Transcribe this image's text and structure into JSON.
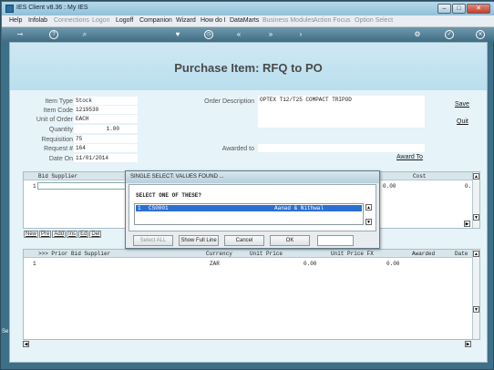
{
  "window": {
    "title": "IES Client v8.36 : My IES",
    "min": "–",
    "max": "□",
    "close": "✕"
  },
  "menu": [
    {
      "label": "Help",
      "enabled": true
    },
    {
      "label": "Infolab",
      "enabled": true
    },
    {
      "label": "Connections",
      "enabled": false
    },
    {
      "label": "Logon",
      "enabled": false
    },
    {
      "label": "Logoff",
      "enabled": true
    },
    {
      "label": "Companion",
      "enabled": true
    },
    {
      "label": "Wizard",
      "enabled": true
    },
    {
      "label": "How do I",
      "enabled": true
    },
    {
      "label": "DataMarts",
      "enabled": true
    },
    {
      "label": "Business Modules",
      "enabled": false
    },
    {
      "label": "Action Focus",
      "enabled": false
    },
    {
      "label": "Option Select",
      "enabled": false
    }
  ],
  "toolbar_icons": [
    "key-icon",
    "help-icon",
    "search-icon",
    "heart-icon",
    "clock-icon",
    "rewind-icon",
    "fast-forward-icon",
    "forward-icon",
    "gear-icon",
    "check-icon",
    "close-icon"
  ],
  "page": {
    "title": "Purchase Item: RFQ to PO"
  },
  "fields": {
    "item_type": {
      "label": "Item Type",
      "value": "Stock"
    },
    "item_code": {
      "label": "Item Code",
      "value": "1219530"
    },
    "unit_of_order": {
      "label": "Unit of Order",
      "value": "EACH"
    },
    "quantity": {
      "label": "Quantity",
      "value": "1.00"
    },
    "requisition": {
      "label": "Requisition",
      "value": "75"
    },
    "request_no": {
      "label": "Request #",
      "value": "164"
    },
    "date_on": {
      "label": "Date On",
      "value": "11/01/2014"
    },
    "order_description": {
      "label": "Order Description",
      "value": "OPTEX T12/T25 COMPACT TRIPOD"
    },
    "awarded_to": {
      "label": "Awarded to",
      "value": ""
    }
  },
  "actions": {
    "save": "Save",
    "quit": "Quit",
    "award_to": "Award To"
  },
  "bid_grid": {
    "columns": [
      "Bid Supplier",
      "Cost"
    ],
    "rows": [
      {
        "num": "1",
        "supplier": "",
        "cost": "0.00",
        "extra": "0."
      }
    ]
  },
  "row_buttons": [
    "New",
    "Pre",
    "Add",
    "Ins",
    "Ed",
    "Del"
  ],
  "prior_grid": {
    "columns": [
      ">>> Prior Bid Supplier",
      "Currency",
      "Unit Price",
      "Unit Price FX",
      "Awarded",
      "Date"
    ],
    "rows": [
      {
        "num": "1",
        "supplier": "",
        "currency": "ZAR",
        "unit_price": "0.00",
        "unit_price_fx": "0.00",
        "awarded": "",
        "date": ""
      }
    ]
  },
  "dialog": {
    "title": "SINGLE SELECT: VALUES FOUND ...",
    "prompt": "SELECT ONE OF THESE?",
    "items": [
      {
        "num": "1",
        "code": "CS0001",
        "name": "Aanad & Nithwal"
      }
    ],
    "buttons": {
      "select_all": "Select ALL",
      "show_full_line": "Show Full Line",
      "cancel": "Cancel",
      "ok": "OK"
    },
    "search_value": ""
  },
  "side_label": "Se"
}
